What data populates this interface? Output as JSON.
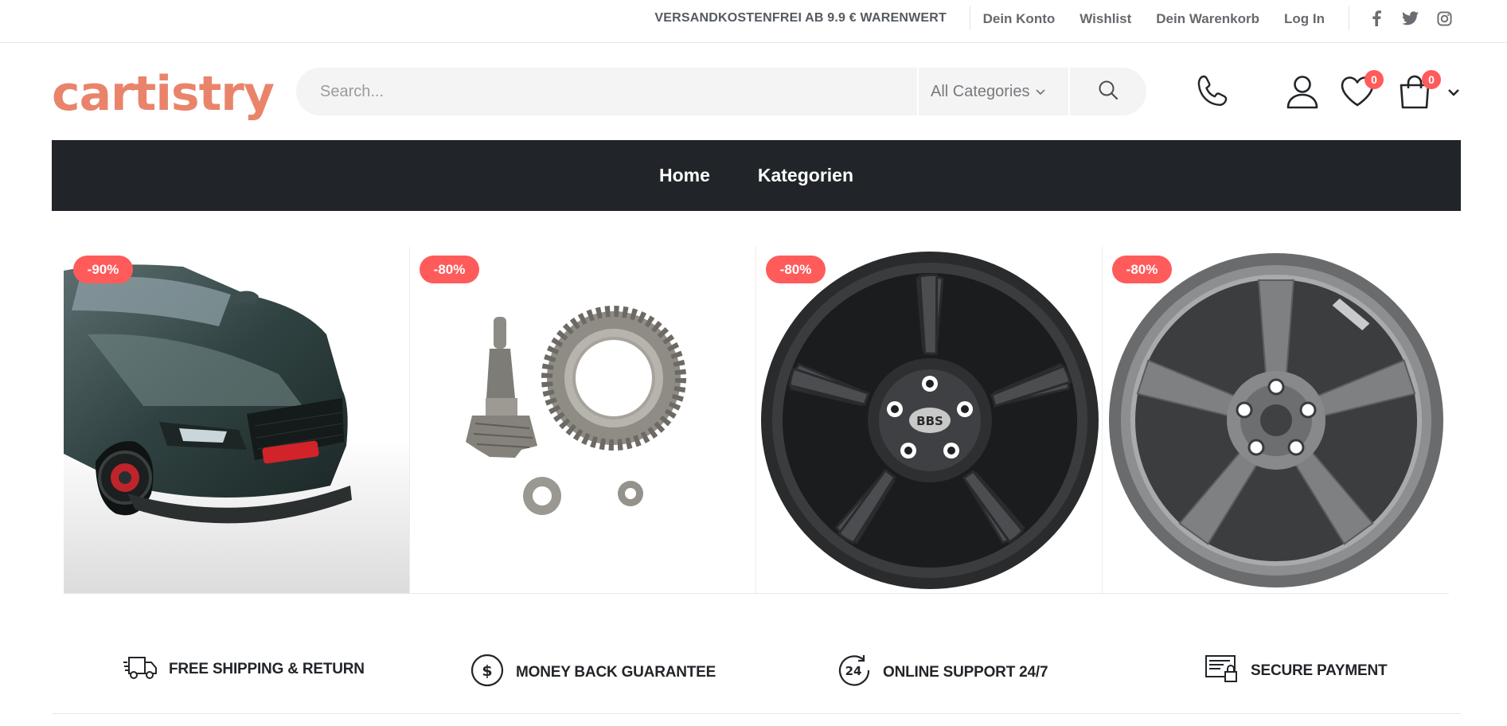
{
  "topbar": {
    "promo": "VERSANDKOSTENFREI AB 9.9 € WARENWERT",
    "links": [
      "Dein Konto",
      "Wishlist",
      "Dein Warenkorb",
      "Log In"
    ],
    "social": [
      "facebook-icon",
      "twitter-icon",
      "instagram-icon"
    ]
  },
  "header": {
    "logo": "cartistry",
    "search_placeholder": "Search...",
    "category_selected": "All Categories",
    "wishlist_count": "0",
    "cart_count": "0"
  },
  "nav": {
    "items": [
      "Home",
      "Kategorien"
    ]
  },
  "products": [
    {
      "badge": "-90%",
      "image": "green sports car front"
    },
    {
      "badge": "-80%",
      "image": "ring and pinion gear set"
    },
    {
      "badge": "-80%",
      "image": "black multi-spoke alloy wheel"
    },
    {
      "badge": "-80%",
      "image": "grey five-spoke alloy wheel"
    }
  ],
  "features": [
    {
      "label": "FREE SHIPPING & RETURN",
      "icon": "truck-icon"
    },
    {
      "label": "MONEY BACK GUARANTEE",
      "icon": "dollar-circle-icon"
    },
    {
      "label": "ONLINE SUPPORT 24/7",
      "icon": "support-24-icon"
    },
    {
      "label": "SECURE PAYMENT",
      "icon": "secure-payment-icon"
    }
  ],
  "colors": {
    "accent": "#e9846b",
    "badge": "#ff5b5b",
    "nav_bg": "#212529"
  }
}
